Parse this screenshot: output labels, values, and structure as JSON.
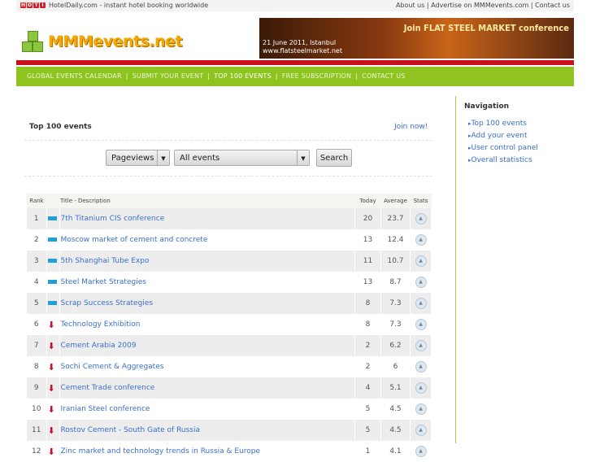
{
  "topbar": {
    "hoti": [
      "H",
      "O",
      "T",
      "I"
    ],
    "tagline": "HotelDaily.com - instant hotel booking worldwide",
    "links": [
      "About us",
      "Advertise on MMMevents.com",
      "Contact us"
    ]
  },
  "logo": {
    "text": "MMMevents.net"
  },
  "banner": {
    "headline": "Join FLAT STEEL MARKET conference",
    "date": "21 June 2011, Istanbul",
    "url": "www.flatsteelmarket.net"
  },
  "nav": {
    "items": [
      "GLOBAL EVENTS CALENDAR",
      "SUBMIT YOUR EVENT",
      "TOP 100 EVENTS",
      "FREE SUBSCRIPTION",
      "CONTACT US"
    ],
    "active": 2
  },
  "main": {
    "title": "Top 100 events",
    "join": "Join now!",
    "metric_select": "Pageviews",
    "filter_select": "All events",
    "search_button": "Search"
  },
  "table": {
    "headers": [
      "Rank",
      "Title - Description",
      "Today",
      "Average",
      "Stats"
    ],
    "rows": [
      {
        "rank": "1",
        "trend": "flat",
        "title": "7th Titanium CIS conference",
        "today": "20",
        "avg": "23.7"
      },
      {
        "rank": "2",
        "trend": "flat",
        "title": "Moscow market of cement and concrete",
        "today": "13",
        "avg": "12.4"
      },
      {
        "rank": "3",
        "trend": "flat",
        "title": "5th Shanghai Tube Expo",
        "today": "11",
        "avg": "10.7"
      },
      {
        "rank": "4",
        "trend": "flat",
        "title": "Steel Market Strategies",
        "today": "13",
        "avg": "8.7"
      },
      {
        "rank": "5",
        "trend": "flat",
        "title": "Scrap Success Strategies",
        "today": "8",
        "avg": "7.3"
      },
      {
        "rank": "6",
        "trend": "down",
        "title": "Technology Exhibition",
        "today": "8",
        "avg": "7.3"
      },
      {
        "rank": "7",
        "trend": "down",
        "title": "Cement Arabia 2009",
        "today": "2",
        "avg": "6.2"
      },
      {
        "rank": "8",
        "trend": "down",
        "title": "Sochi Cement & Aggregates",
        "today": "2",
        "avg": "6"
      },
      {
        "rank": "9",
        "trend": "down",
        "title": "Cement Trade conference",
        "today": "4",
        "avg": "5.1"
      },
      {
        "rank": "10",
        "trend": "down",
        "title": "Iranian Steel conference",
        "today": "5",
        "avg": "4.5"
      },
      {
        "rank": "11",
        "trend": "down",
        "title": "Rostov Cement - South Gate of Russia",
        "today": "5",
        "avg": "4.5"
      },
      {
        "rank": "12",
        "trend": "down",
        "title": "Zinc market and technology trends in Russia & Europe",
        "today": "1",
        "avg": "4.1"
      }
    ]
  },
  "sidebar": {
    "title": "Navigation",
    "links": [
      "Top 100 events",
      "Add your event",
      "User control panel",
      "Overall statistics"
    ]
  }
}
